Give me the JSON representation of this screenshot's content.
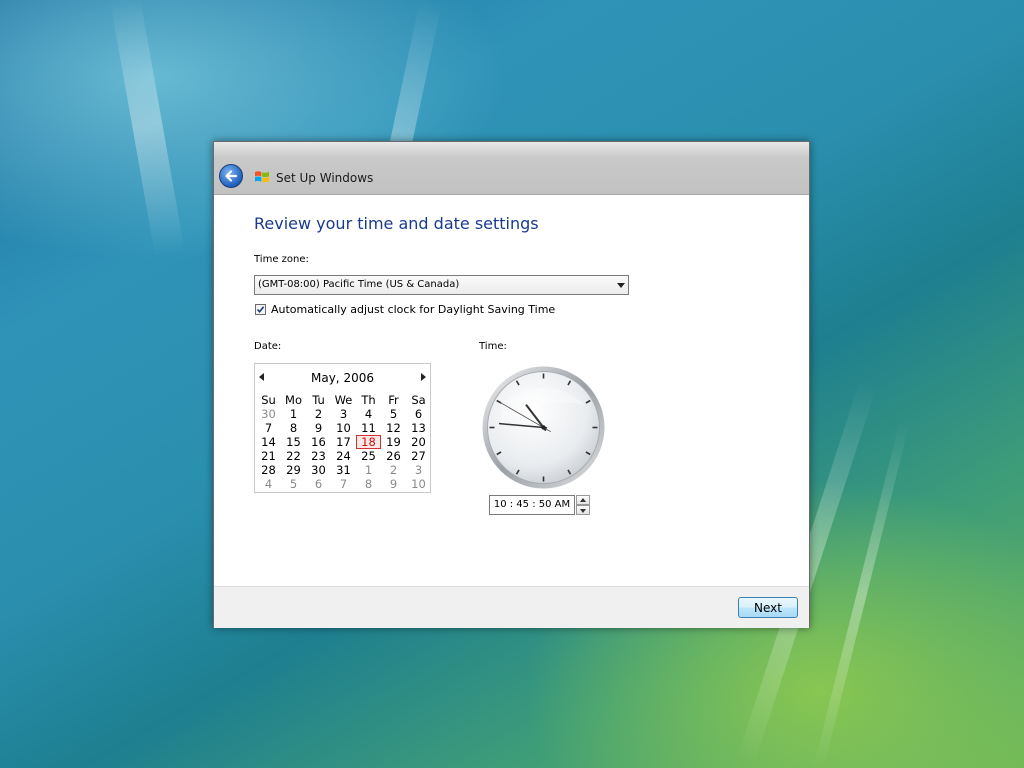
{
  "window": {
    "title": "Set Up Windows"
  },
  "page": {
    "heading": "Review your time and date settings",
    "timezone_label": "Time zone:",
    "timezone_value": "(GMT-08:00) Pacific Time (US & Canada)",
    "dst_label": "Automatically adjust clock for Daylight Saving Time",
    "dst_checked": true,
    "date_label": "Date:",
    "time_label": "Time:"
  },
  "calendar": {
    "month_title": "May, 2006",
    "weekdays": [
      "Su",
      "Mo",
      "Tu",
      "We",
      "Th",
      "Fr",
      "Sa"
    ],
    "weeks": [
      [
        "30",
        "1",
        "2",
        "3",
        "4",
        "5",
        "6"
      ],
      [
        "7",
        "8",
        "9",
        "10",
        "11",
        "12",
        "13"
      ],
      [
        "14",
        "15",
        "16",
        "17",
        "18",
        "19",
        "20"
      ],
      [
        "21",
        "22",
        "23",
        "24",
        "25",
        "26",
        "27"
      ],
      [
        "28",
        "29",
        "30",
        "31",
        "1",
        "2",
        "3"
      ],
      [
        "4",
        "5",
        "6",
        "7",
        "8",
        "9",
        "10"
      ]
    ],
    "selected_day": "18"
  },
  "clock": {
    "hours": 10,
    "minutes": 45,
    "seconds": 50
  },
  "time_field": {
    "value": "10 : 45 : 50  AM"
  },
  "footer": {
    "next_label": "Next"
  },
  "colors": {
    "heading": "#1a3a8c",
    "today_border": "#d23030",
    "next_border": "#3c7fb1"
  },
  "icons": {
    "back": "back-arrow-icon",
    "window": "windows-flag-icon"
  }
}
